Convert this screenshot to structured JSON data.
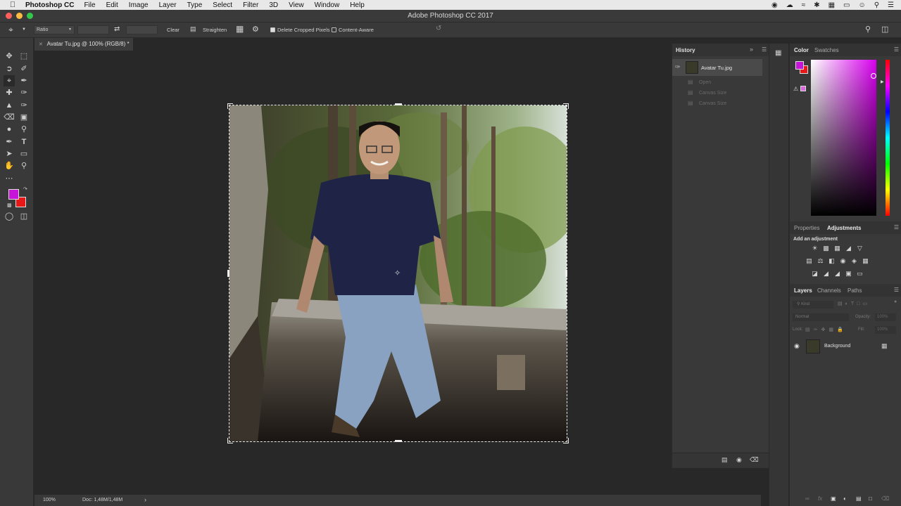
{
  "menubar": {
    "app_name": "Photoshop CC",
    "items": [
      "File",
      "Edit",
      "Image",
      "Layer",
      "Type",
      "Select",
      "Filter",
      "3D",
      "View",
      "Window",
      "Help"
    ]
  },
  "titlebar": {
    "title": "Adobe Photoshop CC 2017"
  },
  "options": {
    "ratio_value": "Ratio",
    "clear_label": "Clear",
    "straighten_label": "Straighten",
    "delete_cropped_label": "Delete Cropped Pixels",
    "delete_cropped_checked": true,
    "content_aware_label": "Content-Aware",
    "content_aware_checked": false
  },
  "document": {
    "tab_title": "Avatar Tu.jpg @ 100% (RGB/8) *"
  },
  "status": {
    "zoom": "100%",
    "doc_info": "Doc: 1,48M/1,48M"
  },
  "history": {
    "tab": "History",
    "snapshot": "Avatar Tu.jpg",
    "steps": [
      "Open",
      "Canvas Size",
      "Canvas Size"
    ]
  },
  "color_panel": {
    "tabs": [
      "Color",
      "Swatches"
    ],
    "foreground": "#c814d8",
    "background": "#e81818"
  },
  "adjustments": {
    "tabs": [
      "Properties",
      "Adjustments"
    ],
    "heading": "Add an adjustment"
  },
  "layers": {
    "tabs": [
      "Layers",
      "Channels",
      "Paths"
    ],
    "kind_placeholder": "Kind",
    "blend_mode": "Normal",
    "opacity_label": "Opacity:",
    "opacity_value": "100%",
    "lock_label": "Lock:",
    "fill_label": "Fill:",
    "fill_value": "100%",
    "layer_name": "Background"
  }
}
